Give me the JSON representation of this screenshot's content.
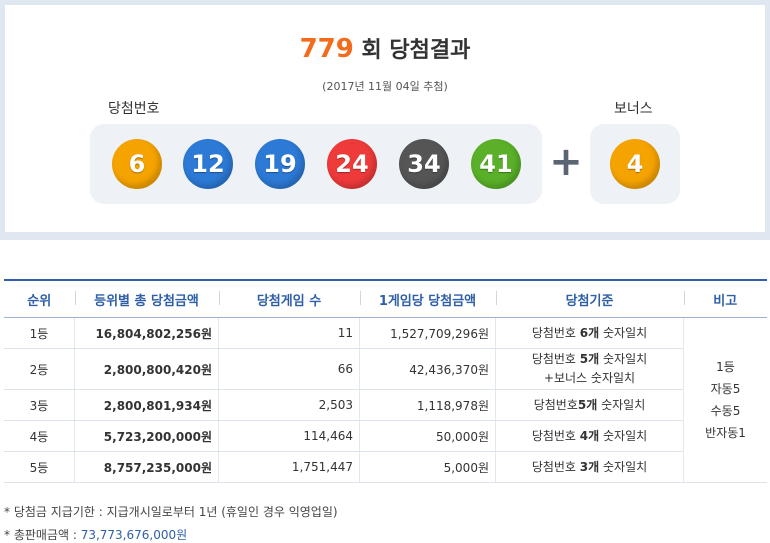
{
  "header": {
    "round": "779",
    "title_suffix": "회 당첨결과",
    "date": "(2017년 11월 04일 추첨)",
    "main_label": "당첨번호",
    "bonus_label": "보너스",
    "plus_symbol": "+"
  },
  "numbers": [
    {
      "value": "6",
      "color": "#f5a300"
    },
    {
      "value": "12",
      "color": "#2c7ad6"
    },
    {
      "value": "19",
      "color": "#2c7ad6"
    },
    {
      "value": "24",
      "color": "#ef3a3a"
    },
    {
      "value": "34",
      "color": "#555555"
    },
    {
      "value": "41",
      "color": "#5ab028"
    }
  ],
  "bonus": {
    "value": "4",
    "color": "#f5a300"
  },
  "table": {
    "headers": [
      "순위",
      "등위별 총 당첨금액",
      "당첨게임 수",
      "1게임당 당첨금액",
      "당첨기준",
      "비고"
    ],
    "rows": [
      {
        "rank": "1등",
        "total": "16,804,802,256원",
        "count": "11",
        "per": "1,527,709,296원",
        "crit_a": "당첨번호 ",
        "crit_b": "6개",
        "crit_c": " 숫자일치",
        "crit2": ""
      },
      {
        "rank": "2등",
        "total": "2,800,800,420원",
        "count": "66",
        "per": "42,436,370원",
        "crit_a": "당첨번호 ",
        "crit_b": "5개",
        "crit_c": " 숫자일치",
        "crit2": "+보너스 숫자일치"
      },
      {
        "rank": "3등",
        "total": "2,800,801,934원",
        "count": "2,503",
        "per": "1,118,978원",
        "crit_a": "당첨번호",
        "crit_b": "5개",
        "crit_c": " 숫자일치",
        "crit2": ""
      },
      {
        "rank": "4등",
        "total": "5,723,200,000원",
        "count": "114,464",
        "per": "50,000원",
        "crit_a": "당첨번호 ",
        "crit_b": "4개",
        "crit_c": " 숫자일치",
        "crit2": ""
      },
      {
        "rank": "5등",
        "total": "8,757,235,000원",
        "count": "1,751,447",
        "per": "5,000원",
        "crit_a": "당첨번호 ",
        "crit_b": "3개",
        "crit_c": " 숫자일치",
        "crit2": ""
      }
    ],
    "note_lines": [
      "1등",
      "자동5",
      "수동5",
      "반자동1"
    ]
  },
  "footer": {
    "deadline": "* 당첨금 지급기한 : 지급개시일로부터 1년 (휴일인 경우 익영업일)",
    "sales_label": "* 총판매금액 : ",
    "sales_value": "73,773,676,000원"
  }
}
